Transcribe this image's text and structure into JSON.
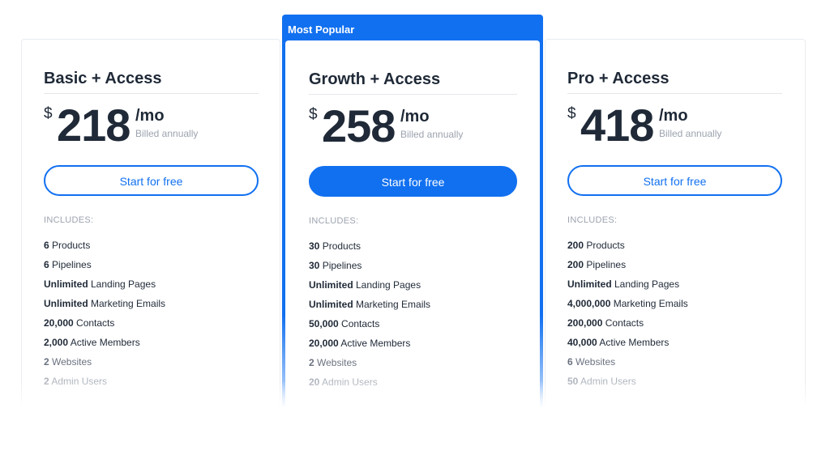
{
  "cards": [
    {
      "name": "Basic + Access",
      "currency": "$",
      "amount": "218",
      "period": "/mo",
      "billing": "Billed annually",
      "cta": "Start for free",
      "includes": "INCLUDES:",
      "features": [
        {
          "bold": "6",
          "rest": " Products"
        },
        {
          "bold": "6",
          "rest": " Pipelines"
        },
        {
          "bold": "Unlimited",
          "rest": " Landing Pages"
        },
        {
          "bold": "Unlimited",
          "rest": " Marketing Emails"
        },
        {
          "bold": "20,000",
          "rest": " Contacts"
        },
        {
          "bold": "2,000",
          "rest": " Active Members"
        },
        {
          "bold": "2",
          "rest": " Websites"
        },
        {
          "bold": "2",
          "rest": " Admin Users"
        }
      ]
    },
    {
      "badge": "Most Popular",
      "name": "Growth + Access",
      "currency": "$",
      "amount": "258",
      "period": "/mo",
      "billing": "Billed annually",
      "cta": "Start for free",
      "includes": "INCLUDES:",
      "features": [
        {
          "bold": "30",
          "rest": " Products"
        },
        {
          "bold": "30",
          "rest": " Pipelines"
        },
        {
          "bold": "Unlimited",
          "rest": " Landing Pages"
        },
        {
          "bold": "Unlimited",
          "rest": " Marketing Emails"
        },
        {
          "bold": "50,000",
          "rest": " Contacts"
        },
        {
          "bold": "20,000",
          "rest": " Active Members"
        },
        {
          "bold": "2",
          "rest": " Websites"
        },
        {
          "bold": "20",
          "rest": " Admin Users"
        }
      ]
    },
    {
      "name": "Pro + Access",
      "currency": "$",
      "amount": "418",
      "period": "/mo",
      "billing": "Billed annually",
      "cta": "Start for free",
      "includes": "INCLUDES:",
      "features": [
        {
          "bold": "200",
          "rest": " Products"
        },
        {
          "bold": "200",
          "rest": " Pipelines"
        },
        {
          "bold": "Unlimited",
          "rest": " Landing Pages"
        },
        {
          "bold": "4,000,000",
          "rest": " Marketing Emails"
        },
        {
          "bold": "200,000",
          "rest": " Contacts"
        },
        {
          "bold": "40,000",
          "rest": " Active Members"
        },
        {
          "bold": "6",
          "rest": " Websites"
        },
        {
          "bold": "50",
          "rest": " Admin Users"
        }
      ]
    }
  ],
  "colors": {
    "accent": "#1170f0",
    "text": "#1f2937",
    "muted": "#9ca3af"
  }
}
